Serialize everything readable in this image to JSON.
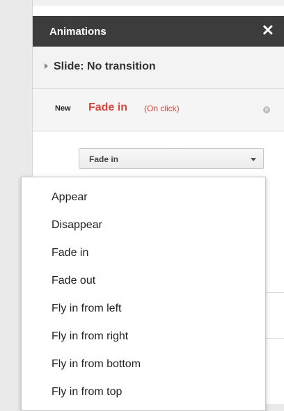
{
  "panel": {
    "title": "Animations",
    "close_icon": "close-icon",
    "close_glyph": "✕"
  },
  "slide_transition": {
    "label": "Slide: No transition"
  },
  "animation": {
    "badge": "New",
    "name": "Fade in",
    "trigger": "(On click)",
    "remove_icon": "remove-icon"
  },
  "effect_select": {
    "selected": "Fade in",
    "options": [
      "Appear",
      "Disappear",
      "Fade in",
      "Fade out",
      "Fly in from left",
      "Fly in from right",
      "Fly in from bottom",
      "Fly in from top"
    ]
  },
  "colors": {
    "header_bg": "#3c3c3c",
    "accent_red": "#d9443b"
  }
}
